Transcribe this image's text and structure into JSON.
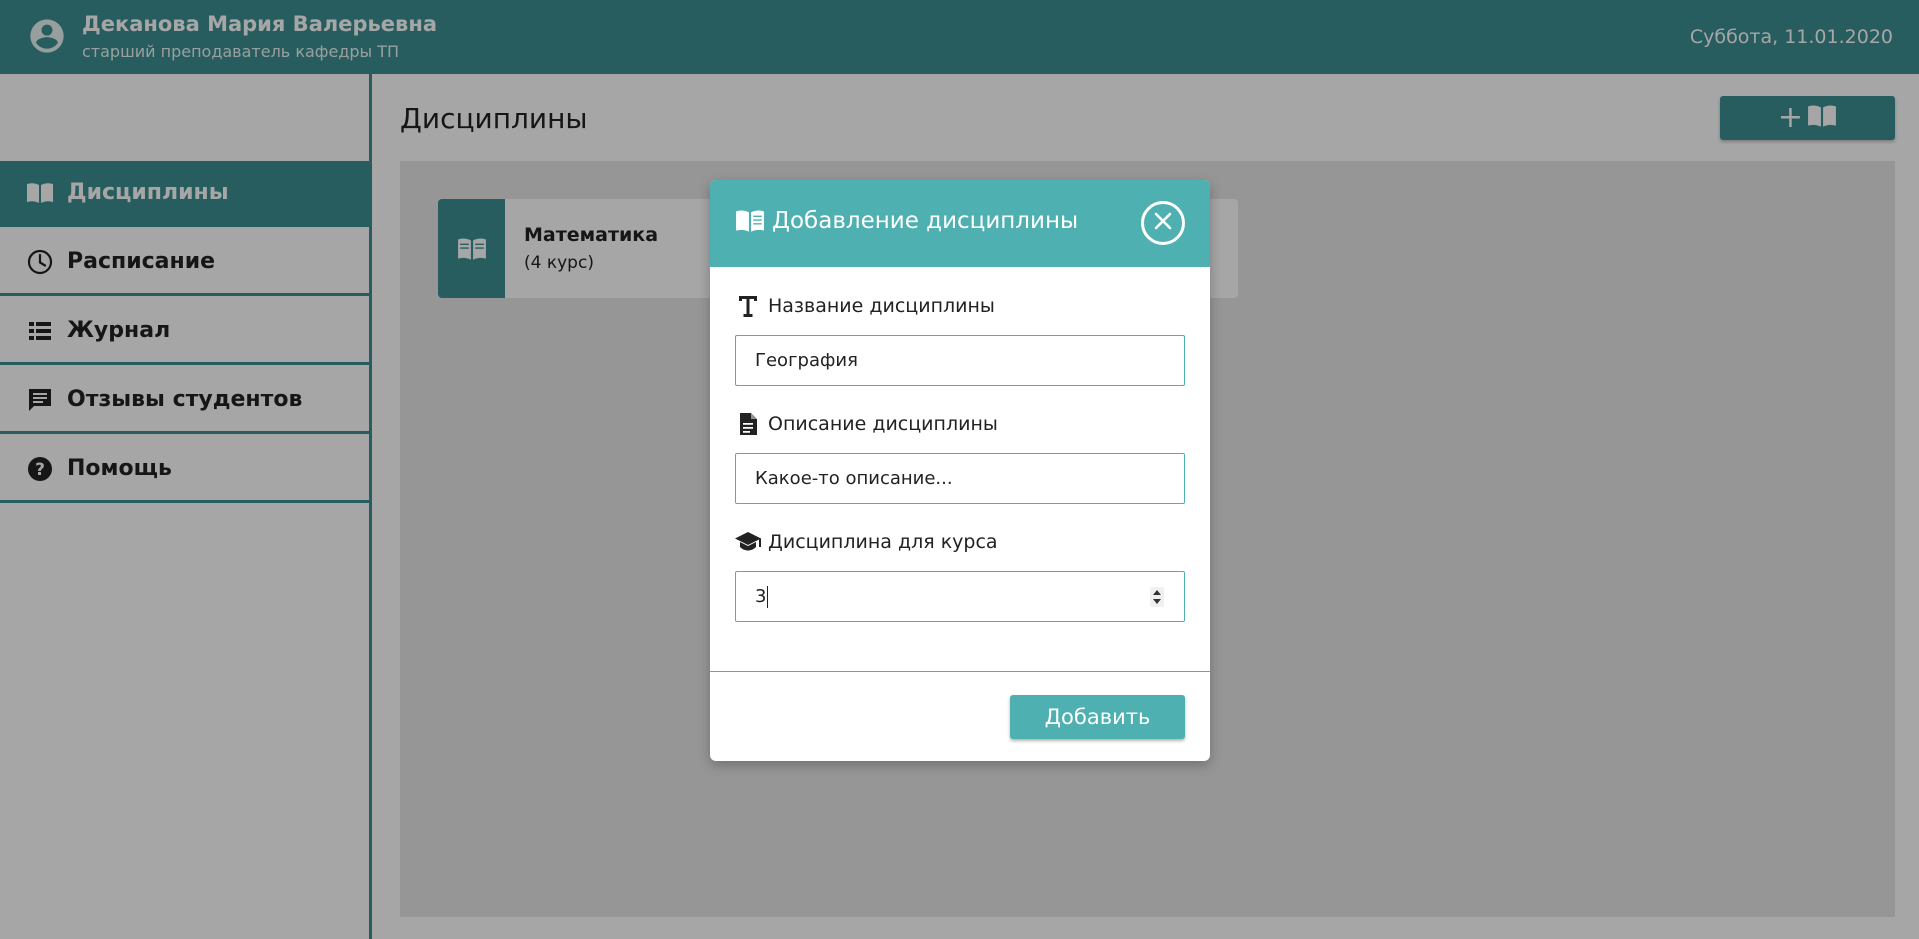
{
  "header": {
    "user_name": "Деканова Мария Валерьевна",
    "user_role": "старший преподаватель кафедры ТП",
    "date": "Суббота, 11.01.2020",
    "avatar_icon": "account-circle-icon"
  },
  "sidebar": {
    "items": [
      {
        "label": "Дисциплины",
        "icon": "book-open-icon",
        "active": true
      },
      {
        "label": "Расписание",
        "icon": "clock-icon",
        "active": false
      },
      {
        "label": "Журнал",
        "icon": "list-icon",
        "active": false
      },
      {
        "label": "Отзывы студентов",
        "icon": "comment-icon",
        "active": false
      },
      {
        "label": "Помощь",
        "icon": "help-circle-icon",
        "active": false
      }
    ]
  },
  "main": {
    "title": "Дисциплины",
    "add_button_glyph": "+",
    "cards": [
      {
        "title": "Математика",
        "subtitle": "(4 курс)",
        "icon": "book-open-icon"
      }
    ]
  },
  "modal": {
    "title": "Добавление дисциплины",
    "fields": [
      {
        "label": "Название дисциплины",
        "icon": "text-icon",
        "value": "География"
      },
      {
        "label": "Описание дисциплины",
        "icon": "document-icon",
        "value": "Какое-то описание..."
      },
      {
        "label": "Дисциплина для курса",
        "icon": "graduation-cap-icon",
        "value": "3"
      }
    ],
    "submit_label": "Добавить"
  },
  "colors": {
    "primary": "#3d8f91",
    "modal_header": "#4fb0b1",
    "content_bg": "#e6e6e6"
  }
}
